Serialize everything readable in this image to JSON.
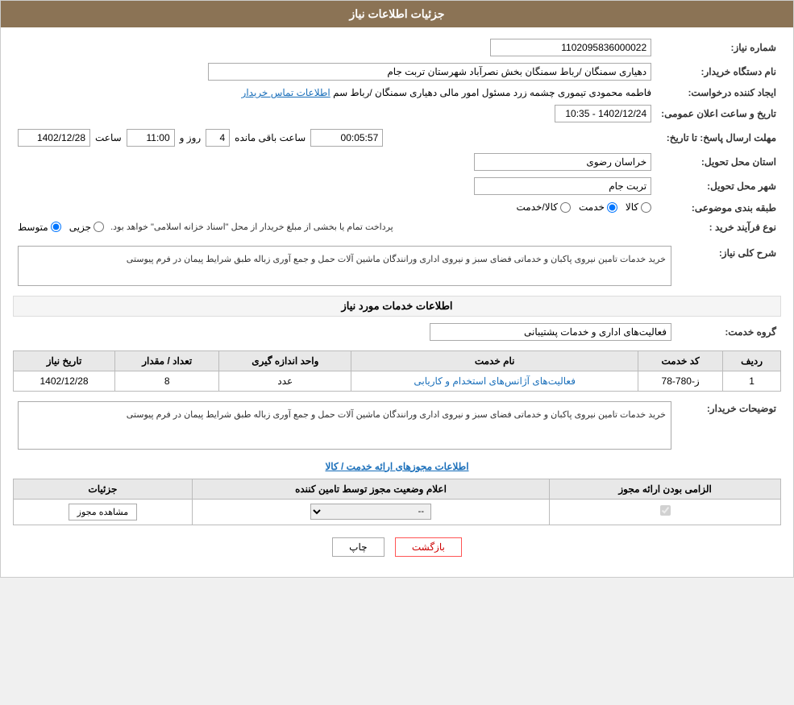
{
  "header": {
    "title": "جزئیات اطلاعات نیاز"
  },
  "fields": {
    "need_number_label": "شماره نیاز:",
    "need_number_value": "1102095836000022",
    "buyer_org_label": "نام دستگاه خریدار:",
    "buyer_org_value": "دهیاری سمنگان /رباط سمنگان بخش نصرآباد شهرستان تربت جام",
    "creator_label": "ایجاد کننده درخواست:",
    "creator_value": "فاطمه محمودی تیموری چشمه زرد مسئول امور مالی دهیاری سمنگان /رباط سم",
    "creator_link": "اطلاعات تماس خریدار",
    "announce_label": "تاریخ و ساعت اعلان عمومی:",
    "announce_value": "1402/12/24 - 10:35",
    "response_deadline_label": "مهلت ارسال پاسخ: تا تاریخ:",
    "response_date": "1402/12/28",
    "response_time_label": "ساعت",
    "response_time": "11:00",
    "response_days_label": "روز و",
    "response_days": "4",
    "response_remaining_label": "ساعت باقی مانده",
    "response_remaining": "00:05:57",
    "province_label": "استان محل تحویل:",
    "province_value": "خراسان رضوی",
    "city_label": "شهر محل تحویل:",
    "city_value": "تربت جام",
    "category_label": "طبقه بندی موضوعی:",
    "category_goods": "کالا",
    "category_service": "خدمت",
    "category_goods_service": "کالا/خدمت",
    "purchase_type_label": "نوع فرآیند خرید :",
    "purchase_partial": "جزیی",
    "purchase_medium": "متوسط",
    "purchase_note": "پرداخت تمام یا بخشی از مبلغ خریدار از محل \"اسناد خزانه اسلامی\" خواهد بود.",
    "need_desc_label": "شرح کلی نیاز:",
    "need_desc_value": "خرید خدمات تامین نیروی پاکبان و خدماتی فضای سبز و نیروی اداری ورانندگان ماشین آلات حمل و جمع آوری زباله طبق شرایط پیمان در فرم پیوستی",
    "service_info_title": "اطلاعات خدمات مورد نیاز",
    "service_group_label": "گروه خدمت:",
    "service_group_value": "فعالیت‌های اداری و خدمات پشتیبانی",
    "service_table": {
      "headers": [
        "ردیف",
        "کد خدمت",
        "نام خدمت",
        "واحد اندازه گیری",
        "تعداد / مقدار",
        "تاریخ نیاز"
      ],
      "rows": [
        {
          "row": "1",
          "code": "ز-780-78",
          "name": "فعالیت‌های آژانس‌های استخدام و کاریابی",
          "unit": "عدد",
          "quantity": "8",
          "date": "1402/12/28"
        }
      ]
    },
    "buyer_notes_label": "توضیحات خریدار:",
    "buyer_notes_value": "خرید خدمات تامین نیروی پاکبان و خدماتی فضای سبز و نیروی اداری ورانندگان ماشین آلات حمل و جمع آوری زباله طبق شرایط پیمان در فرم پیوستی",
    "permit_section_title": "اطلاعات مجوزهای ارائه خدمت / کالا",
    "permit_table": {
      "headers": [
        "الزامی بودن ارائه مجوز",
        "اعلام وضعیت مجوز توسط تامین کننده",
        "جزئیات"
      ],
      "rows": [
        {
          "required": true,
          "status": "--",
          "details_btn": "مشاهده مجوز"
        }
      ]
    },
    "btn_print": "چاپ",
    "btn_back": "بازگشت"
  }
}
